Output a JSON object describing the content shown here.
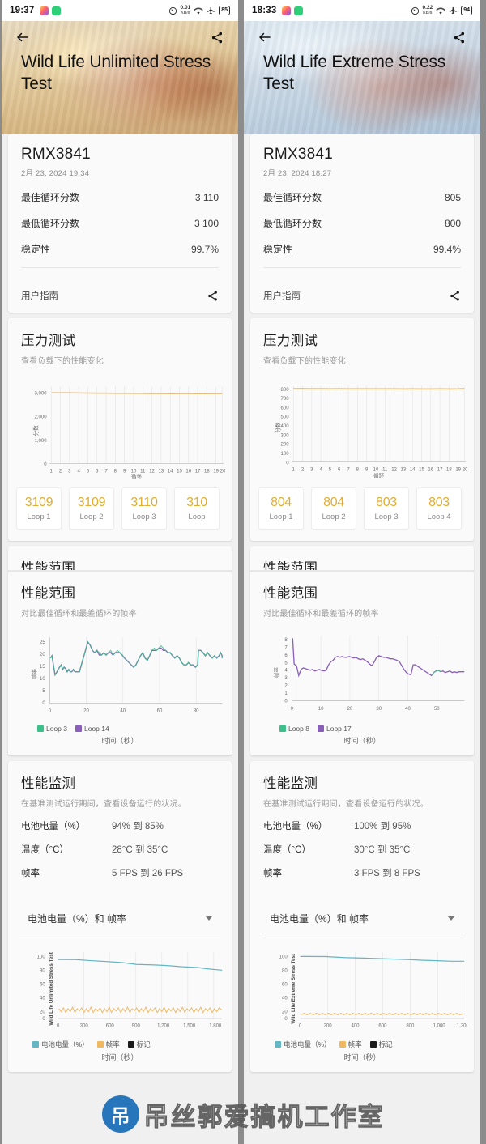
{
  "panels": [
    {
      "statusbar": {
        "time": "19:37",
        "speed_value": "0.01",
        "speed_unit": "KB/s",
        "battery": "85",
        "icons": [
          "speed-icon",
          "wifi-icon",
          "airplane-icon",
          "battery-icon"
        ]
      },
      "hero": {
        "title": "Wild Life Unlimited Stress Test",
        "back_icon": "back-arrow-icon",
        "share_icon": "share-icon"
      },
      "summary": {
        "device": "RMX3841",
        "date": "2月 23, 2024 19:34",
        "rows": [
          {
            "label": "最佳循环分数",
            "value": "3 110"
          },
          {
            "label": "最低循环分数",
            "value": "3 100"
          },
          {
            "label": "稳定性",
            "value": "99.7%"
          }
        ],
        "guide_label": "用户指南",
        "guide_share_icon": "share-icon"
      },
      "stress": {
        "title": "压力测试",
        "subtitle": "查看负载下的性能变化"
      },
      "loops": [
        {
          "score": "3109",
          "label": "Loop 1"
        },
        {
          "score": "3109",
          "label": "Loop 2"
        },
        {
          "score": "3110",
          "label": "Loop 3"
        },
        {
          "score": "310",
          "label": "Loop"
        }
      ],
      "range": {
        "title": "性能范围",
        "subtitle": "对比最佳循环和最差循环的帧率"
      },
      "monitor": {
        "title": "性能监测",
        "subtitle": "在基准测试运行期间，查看设备运行的状况。",
        "rows": [
          {
            "label": "电池电量（%）",
            "value": "94% 到 85%"
          },
          {
            "label": "温度（°C）",
            "value": "28°C 到 35°C"
          },
          {
            "label": "帧率",
            "value": "5 FPS 到 26 FPS"
          }
        ],
        "select_value": "电池电量（%）和 帧率",
        "select_icon": "chevron-down-icon"
      },
      "chart_data": [
        {
          "type": "line",
          "title": "压力测试",
          "xlabel": "循环",
          "ylabel": "分数",
          "x": [
            1,
            2,
            3,
            4,
            5,
            6,
            7,
            8,
            9,
            10,
            11,
            12,
            13,
            14,
            15,
            16,
            17,
            18,
            19,
            20
          ],
          "xticklabels": [
            "1",
            "2",
            "3",
            "4",
            "5",
            "6",
            "7",
            "8",
            "9",
            "10",
            "11",
            "12",
            "13",
            "14",
            "15",
            "16",
            "17",
            "18",
            "19",
            "20"
          ],
          "yticklabels": [
            "0",
            "1,000",
            "2,000",
            "3,000"
          ],
          "ylim": [
            0,
            3300
          ],
          "grid": true,
          "series": [
            {
              "name": "分数",
              "color": "#e2b26b",
              "values": [
                3109,
                3109,
                3110,
                3108,
                3107,
                3106,
                3105,
                3104,
                3104,
                3103,
                3103,
                3102,
                3102,
                3100,
                3101,
                3101,
                3100,
                3100,
                3101,
                3102
              ]
            }
          ]
        },
        {
          "type": "line",
          "title": "性能范围",
          "xlabel": "时间（秒）",
          "ylabel": "帧率",
          "xticklabels": [
            "0",
            "20",
            "40",
            "60",
            "80"
          ],
          "yticklabels": [
            "0",
            "5",
            "10",
            "15",
            "20",
            "25"
          ],
          "xlim": [
            0,
            95
          ],
          "ylim": [
            0,
            27
          ],
          "legend": [
            "Loop 3",
            "Loop 14"
          ],
          "legend_position": "bottom-left",
          "series": [
            {
              "name": "Loop 3",
              "color": "#3dbf8a",
              "values": [
                19,
                20,
                16,
                12,
                13,
                14,
                15,
                16,
                14,
                15,
                14,
                13,
                14,
                13,
                13,
                14,
                13,
                13,
                13,
                13,
                23,
                25,
                24,
                22,
                21,
                22,
                21,
                20,
                21,
                20,
                21,
                22,
                20,
                21,
                22,
                21,
                20,
                19,
                18,
                17,
                16,
                15,
                16,
                18,
                20,
                21,
                19,
                18,
                20,
                22,
                23,
                22,
                23,
                24,
                23,
                22,
                22,
                21,
                20,
                19,
                20,
                19,
                17,
                16,
                16,
                17,
                16,
                16,
                15,
                16,
                22,
                22,
                21,
                20,
                21,
                20,
                19,
                20,
                19,
                20,
                21,
                20,
                19,
                18,
                17,
                17,
                18,
                17,
                18,
                19,
                18
              ]
            },
            {
              "name": "Loop 14",
              "color": "#8a5fb8",
              "values": [
                19,
                20,
                16,
                12,
                13,
                14,
                15,
                16,
                14,
                15,
                14,
                13,
                14,
                13,
                13,
                14,
                13,
                13,
                13,
                13,
                23,
                25,
                24,
                22,
                21,
                22,
                20,
                20,
                21,
                20,
                21,
                21,
                20,
                21,
                21,
                21,
                20,
                19,
                18,
                17,
                16,
                15,
                16,
                18,
                20,
                21,
                19,
                18,
                20,
                22,
                22,
                22,
                23,
                23,
                22,
                22,
                21,
                21,
                20,
                19,
                20,
                19,
                17,
                16,
                16,
                17,
                16,
                16,
                15,
                16,
                22,
                22,
                21,
                20,
                21,
                20,
                19,
                20,
                19,
                20,
                21,
                20,
                19,
                18,
                17,
                17,
                18,
                17,
                18,
                19,
                18
              ]
            }
          ]
        },
        {
          "type": "line",
          "title": "性能监测",
          "xlabel": "时间（秒）",
          "ylabel": "Wild Life Unlimited Stress Test",
          "xticklabels": [
            "0",
            "300",
            "600",
            "900",
            "1,200",
            "1,500",
            "1,800"
          ],
          "yticklabels": [
            "0",
            "20",
            "40",
            "60",
            "80",
            "100"
          ],
          "xlim": [
            0,
            1900
          ],
          "ylim": [
            0,
            108
          ],
          "legend": [
            "电池电量（%）",
            "帧率",
            "标记"
          ],
          "legend_position": "bottom",
          "series": [
            {
              "name": "电池电量（%）",
              "color": "#64b6c4",
              "values": [
                94,
                94,
                93,
                93,
                92,
                92,
                91,
                91,
                90,
                89,
                89,
                88,
                88,
                87,
                87,
                86,
                86,
                85,
                85
              ]
            },
            {
              "name": "帧率",
              "color": "#f0b860",
              "values": [
                19,
                17,
                20,
                16,
                19,
                17,
                21,
                16,
                19,
                18,
                20,
                16,
                19,
                17,
                20,
                17,
                19,
                18,
                20,
                17
              ]
            },
            {
              "name": "标记",
              "color": "#1b1b1b",
              "values": []
            }
          ]
        }
      ]
    },
    {
      "statusbar": {
        "time": "18:33",
        "speed_value": "0.22",
        "speed_unit": "KB/s",
        "battery": "94",
        "icons": [
          "speed-icon",
          "wifi-icon",
          "airplane-icon",
          "battery-icon"
        ]
      },
      "hero": {
        "title": "Wild Life Extreme Stress Test",
        "back_icon": "back-arrow-icon",
        "share_icon": "share-icon"
      },
      "summary": {
        "device": "RMX3841",
        "date": "2月 23, 2024 18:27",
        "rows": [
          {
            "label": "最佳循环分数",
            "value": "805"
          },
          {
            "label": "最低循环分数",
            "value": "800"
          },
          {
            "label": "稳定性",
            "value": "99.4%"
          }
        ],
        "guide_label": "用户指南",
        "guide_share_icon": "share-icon"
      },
      "stress": {
        "title": "压力测试",
        "subtitle": "查看负载下的性能变化"
      },
      "loops": [
        {
          "score": "804",
          "label": "Loop 1"
        },
        {
          "score": "804",
          "label": "Loop 2"
        },
        {
          "score": "803",
          "label": "Loop 3"
        },
        {
          "score": "803",
          "label": "Loop 4"
        }
      ],
      "range": {
        "title": "性能范围",
        "subtitle": "对比最佳循环和最差循环的帧率"
      },
      "monitor": {
        "title": "性能监测",
        "subtitle": "在基准测试运行期间，查看设备运行的状况。",
        "rows": [
          {
            "label": "电池电量（%）",
            "value": "100% 到 95%"
          },
          {
            "label": "温度（°C）",
            "value": "30°C 到 35°C"
          },
          {
            "label": "帧率",
            "value": "3 FPS 到 8 FPS"
          }
        ],
        "select_value": "电池电量（%）和 帧率",
        "select_icon": "chevron-down-icon"
      },
      "chart_data": [
        {
          "type": "line",
          "title": "压力测试",
          "xlabel": "循环",
          "ylabel": "分数",
          "x": [
            1,
            2,
            3,
            4,
            5,
            6,
            7,
            8,
            9,
            10,
            11,
            12,
            13,
            14,
            15,
            16,
            17,
            18,
            19,
            20
          ],
          "xticklabels": [
            "1",
            "2",
            "3",
            "4",
            "5",
            "6",
            "7",
            "8",
            "9",
            "10",
            "11",
            "12",
            "13",
            "14",
            "15",
            "16",
            "17",
            "18",
            "19",
            "20"
          ],
          "yticklabels": [
            "0",
            "100",
            "200",
            "300",
            "400",
            "500",
            "600",
            "700",
            "800"
          ],
          "ylim": [
            0,
            850
          ],
          "grid": true,
          "series": [
            {
              "name": "分数",
              "color": "#e2b26b",
              "values": [
                804,
                804,
                803,
                803,
                802,
                803,
                802,
                802,
                801,
                802,
                801,
                801,
                800,
                801,
                800,
                800,
                801,
                800,
                801,
                805
              ]
            }
          ]
        },
        {
          "type": "line",
          "title": "性能范围",
          "xlabel": "时间（秒）",
          "ylabel": "帧率",
          "xticklabels": [
            "0",
            "10",
            "20",
            "30",
            "40",
            "50"
          ],
          "yticklabels": [
            "0",
            "1",
            "2",
            "3",
            "4",
            "5",
            "6",
            "7",
            "8"
          ],
          "xlim": [
            0,
            58
          ],
          "ylim": [
            0,
            8.6
          ],
          "legend": [
            "Loop 8",
            "Loop 17"
          ],
          "legend_position": "bottom-left",
          "series": [
            {
              "name": "Loop 8",
              "color": "#3dbf8a",
              "values": [
                8.3,
                5,
                4.8,
                3.5,
                4.3,
                4.5,
                4.4,
                4.3,
                4.2,
                4.3,
                4.1,
                4.2,
                4.3,
                4.2,
                4.1,
                4.2,
                4.1,
                4.1,
                4.3,
                4.2,
                4.1,
                4.2,
                5.2,
                5.4,
                5.3,
                5.6,
                5.8,
                5.7,
                5.6,
                5.8,
                5.6,
                5.9,
                5.7,
                5.6,
                5.5,
                5.6,
                5.4,
                5.3,
                5.4,
                5.2,
                4.9,
                4.7,
                5.4,
                5.6,
                5.9,
                5.8,
                5.7,
                5.6,
                5.5,
                5.5,
                5.4,
                5.2,
                4.7,
                4.3,
                4,
                3.9,
                3.8,
                4.9,
                4.8,
                4.6,
                4.5,
                4.3,
                4.2,
                3.6,
                4.4,
                4.3,
                4.1,
                4.3,
                3.9,
                4.1,
                4,
                4.1
              ]
            },
            {
              "name": "Loop 17",
              "color": "#8a5fb8",
              "values": [
                8.3,
                5,
                4.8,
                3.5,
                4.3,
                4.5,
                4.4,
                4.3,
                4.2,
                4.3,
                4.1,
                4.2,
                4.3,
                4.2,
                4.1,
                4.2,
                4.1,
                4.1,
                4.3,
                4.2,
                4.1,
                4.2,
                5.2,
                5.4,
                5.3,
                5.6,
                5.8,
                5.7,
                5.6,
                5.8,
                5.6,
                5.9,
                5.7,
                5.6,
                5.5,
                5.6,
                5.4,
                5.3,
                5.4,
                5.2,
                4.9,
                4.7,
                5.4,
                5.6,
                5.9,
                5.8,
                5.7,
                5.6,
                5.5,
                5.5,
                5.4,
                5.2,
                4.7,
                4.3,
                4,
                3.9,
                3.8,
                4.9,
                4.8,
                4.6,
                4.5,
                4.3,
                4.2,
                3.6,
                4.4,
                4.3,
                4.1,
                4.3,
                3.9,
                4.1,
                4,
                4.1
              ]
            }
          ]
        },
        {
          "type": "line",
          "title": "性能监测",
          "xlabel": "时间（秒）",
          "ylabel": "Wild Life Extreme Stress Test",
          "xticklabels": [
            "0",
            "200",
            "400",
            "600",
            "800",
            "1,000",
            "1,200"
          ],
          "yticklabels": [
            "0",
            "20",
            "40",
            "60",
            "80",
            "100"
          ],
          "xlim": [
            0,
            1250
          ],
          "ylim": [
            0,
            108
          ],
          "legend": [
            "电池电量（%）",
            "帧率",
            "标记"
          ],
          "legend_position": "bottom",
          "series": [
            {
              "name": "电池电量（%）",
              "color": "#64b6c4",
              "values": [
                100,
                100,
                100,
                100,
                99,
                99,
                98,
                98,
                98,
                97,
                97,
                97,
                96,
                96,
                96,
                95,
                95
              ]
            },
            {
              "name": "帧率",
              "color": "#f0b860",
              "values": [
                5,
                4,
                5,
                4,
                5,
                4,
                5,
                4,
                5,
                4,
                5,
                4,
                5,
                4,
                5,
                4,
                5,
                4,
                5,
                4
              ]
            },
            {
              "name": "标记",
              "color": "#1b1b1b",
              "values": []
            }
          ]
        }
      ]
    }
  ],
  "watermark": {
    "logo": "吊",
    "text": "吊丝郭爱搞机工作室"
  }
}
